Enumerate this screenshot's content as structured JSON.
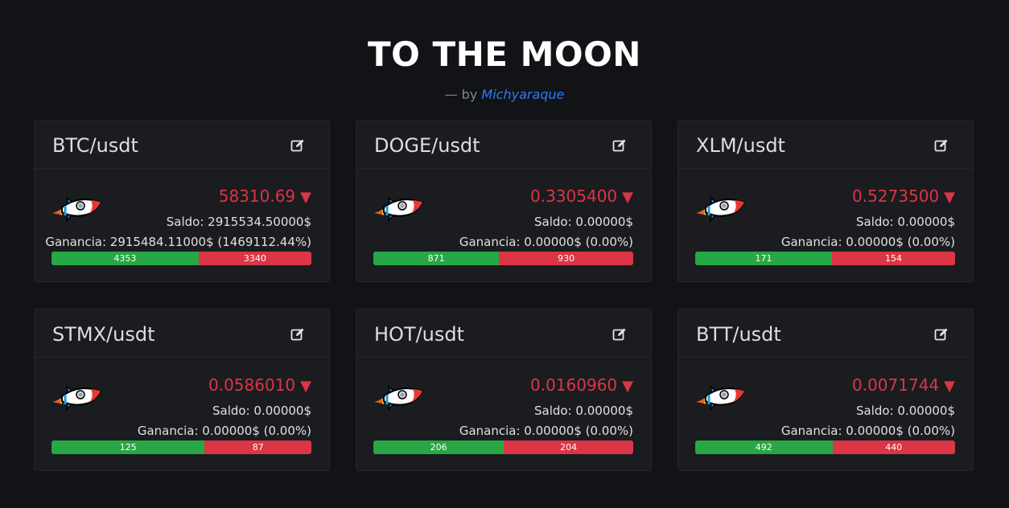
{
  "header": {
    "title": "TO THE MOON",
    "by_prefix": "— by",
    "author": "Michyaraque"
  },
  "colors": {
    "background": "#121316",
    "card": "#1a1c20",
    "price_down": "#dc3545",
    "bar_buy": "#28a745",
    "bar_sell": "#dc3545",
    "author_link": "#2a7cf6"
  },
  "icons": {
    "edit": "edit-icon",
    "rocket": "rocket-icon",
    "trend_down": "arrow-down-icon"
  },
  "cards": [
    {
      "pair": "BTC/usdt",
      "price": "58310.69",
      "arrow": "▼",
      "saldo": "Saldo: 2915534.50000$",
      "ganancia": "Ganancia: 2915484.11000$ (1469112.44%)",
      "buy": "4353",
      "sell": "3340"
    },
    {
      "pair": "DOGE/usdt",
      "price": "0.3305400",
      "arrow": "▼",
      "saldo": "Saldo: 0.00000$",
      "ganancia": "Ganancia: 0.00000$ (0.00%)",
      "buy": "871",
      "sell": "930"
    },
    {
      "pair": "XLM/usdt",
      "price": "0.5273500",
      "arrow": "▼",
      "saldo": "Saldo: 0.00000$",
      "ganancia": "Ganancia: 0.00000$ (0.00%)",
      "buy": "171",
      "sell": "154"
    },
    {
      "pair": "STMX/usdt",
      "price": "0.0586010",
      "arrow": "▼",
      "saldo": "Saldo: 0.00000$",
      "ganancia": "Ganancia: 0.00000$ (0.00%)",
      "buy": "125",
      "sell": "87"
    },
    {
      "pair": "HOT/usdt",
      "price": "0.0160960",
      "arrow": "▼",
      "saldo": "Saldo: 0.00000$",
      "ganancia": "Ganancia: 0.00000$ (0.00%)",
      "buy": "206",
      "sell": "204"
    },
    {
      "pair": "BTT/usdt",
      "price": "0.0071744",
      "arrow": "▼",
      "saldo": "Saldo: 0.00000$",
      "ganancia": "Ganancia: 0.00000$ (0.00%)",
      "buy": "492",
      "sell": "440"
    }
  ]
}
